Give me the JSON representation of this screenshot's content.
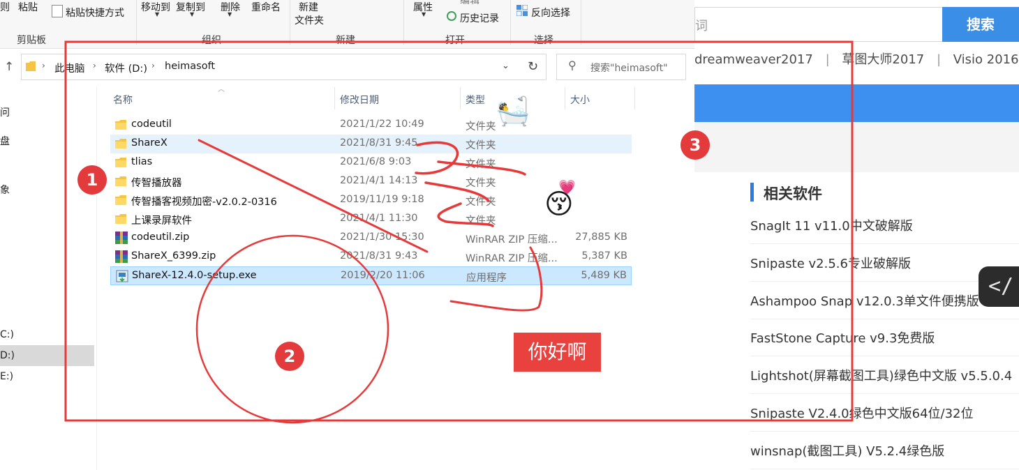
{
  "ribbon": {
    "paste_partial": "则",
    "paste": "粘贴",
    "paste_shortcut": "粘贴快捷方式",
    "move_to": "移动到",
    "copy_to": "复制到",
    "delete": "删除",
    "rename": "重命名",
    "new_folder_l1": "新建",
    "new_folder_l2": "文件夹",
    "properties": "属性",
    "edit_partial": "编辑",
    "history": "历史记录",
    "invert_selection": "反向选择",
    "groups": {
      "clipboard": "剪贴板",
      "organize": "组织",
      "new": "新建",
      "open": "打开",
      "select": "选择"
    }
  },
  "address": {
    "up_arrow": "↑",
    "crumbs": [
      "此电脑",
      "软件 (D:)",
      "heimasoft"
    ],
    "search_placeholder": "搜索\"heimasoft\""
  },
  "nav": {
    "items": [
      "问",
      "盘",
      "象",
      "C:)",
      "D:)",
      "E:)"
    ],
    "selected": "D:)"
  },
  "columns": {
    "name": "名称",
    "modified": "修改日期",
    "type": "类型",
    "size": "大小"
  },
  "files": [
    {
      "name": "codeutil",
      "date": "2021/1/22 10:49",
      "type": "文件夹",
      "size": "",
      "kind": "folder",
      "state": "normal"
    },
    {
      "name": "ShareX",
      "date": "2021/8/31 9:45",
      "type": "文件夹",
      "size": "",
      "kind": "folder",
      "state": "hover"
    },
    {
      "name": "tlias",
      "date": "2021/6/8 9:03",
      "type": "文件夹",
      "size": "",
      "kind": "folder",
      "state": "normal"
    },
    {
      "name": "传智播放器",
      "date": "2021/4/1 14:13",
      "type": "文件夹",
      "size": "",
      "kind": "folder",
      "state": "normal"
    },
    {
      "name": "传智播客视频加密-v2.0.2-0316",
      "date": "2019/11/19 9:18",
      "type": "文件夹",
      "size": "",
      "kind": "folder",
      "state": "normal"
    },
    {
      "name": "上课录屏软件",
      "date": "2021/4/1 11:30",
      "type": "文件夹",
      "size": "",
      "kind": "folder",
      "state": "normal"
    },
    {
      "name": "codeutil.zip",
      "date": "2021/1/30 15:30",
      "type": "WinRAR ZIP 压缩...",
      "size": "27,885 KB",
      "kind": "zip",
      "state": "normal"
    },
    {
      "name": "ShareX_6399.zip",
      "date": "2021/8/31 9:43",
      "type": "WinRAR ZIP 压缩...",
      "size": "5,387 KB",
      "kind": "zip",
      "state": "normal"
    },
    {
      "name": "ShareX-12.4.0-setup.exe",
      "date": "2019/2/20 11:06",
      "type": "应用程序",
      "size": "5,489 KB",
      "kind": "exe",
      "state": "selected"
    }
  ],
  "web": {
    "search_partial": "词",
    "search_button": "搜索",
    "tags": [
      "dreamweaver2017",
      "草图大师2017",
      "Visio 2016"
    ],
    "tag_separator": "|",
    "related_title": "相关软件",
    "related": [
      "SnagIt 11 v11.0中文破解版",
      "Snipaste v2.5.6专业破解版",
      "Ashampoo Snap v12.0.3单文件便携版",
      "FastStone Capture v9.3免费版",
      "Lightshot(屏幕截图工具)绿色中文版 v5.5.0.4",
      "Snipaste V2.4.0绿色中文版64位/32位",
      "winsnap(截图工具) V5.2.4绿色版"
    ],
    "code_icon": "</"
  },
  "annotations": {
    "badges": [
      "1",
      "2",
      "3"
    ],
    "hello_text": "你好啊",
    "emoji_bath": "🛀",
    "emoji_kiss": "😚",
    "emoji_heart": "💗",
    "accent_color": "#e33b3b"
  }
}
